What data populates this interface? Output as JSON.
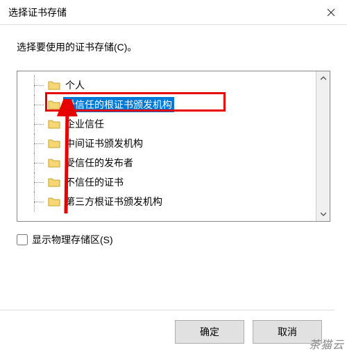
{
  "titlebar": {
    "title": "选择证书存储"
  },
  "instruction": "选择要使用的证书存储(C)。",
  "tree": {
    "items": [
      {
        "label": "个人",
        "selected": false
      },
      {
        "label": "受信任的根证书颁发机构",
        "selected": true
      },
      {
        "label": "企业信任",
        "selected": false
      },
      {
        "label": "中间证书颁发机构",
        "selected": false
      },
      {
        "label": "受信任的发布者",
        "selected": false
      },
      {
        "label": "不信任的证书",
        "selected": false
      },
      {
        "label": "第三方根证书颁发机构",
        "selected": false
      }
    ]
  },
  "checkbox": {
    "label": "显示物理存储区(S)",
    "checked": false
  },
  "buttons": {
    "ok": "确定",
    "cancel": "取消"
  },
  "watermark": "茶猫云"
}
